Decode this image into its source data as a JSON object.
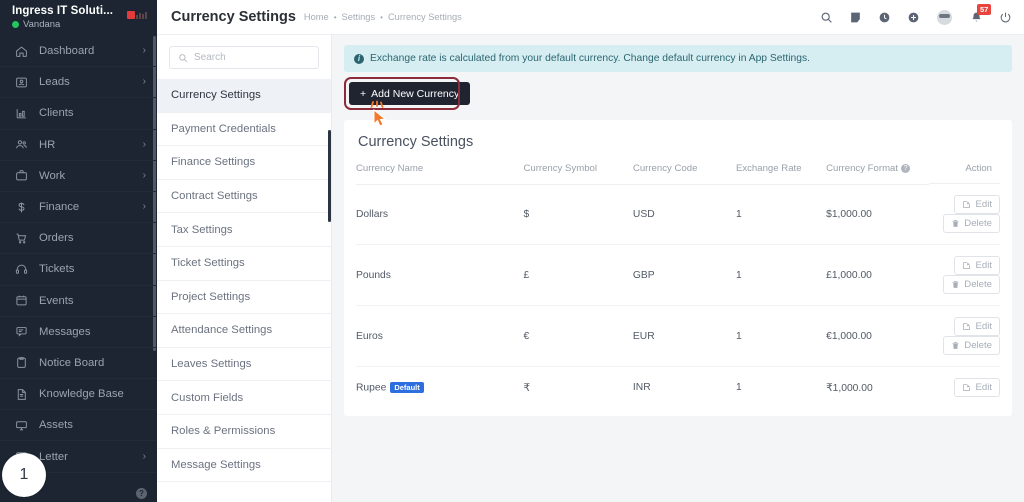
{
  "sidebar": {
    "brand_title": "Ingress IT Soluti...",
    "user_name": "Vandana",
    "step_badge": "1",
    "items": [
      {
        "label": "Dashboard",
        "icon": "home-icon",
        "chevron": "›"
      },
      {
        "label": "Leads",
        "icon": "leads-icon",
        "chevron": "›"
      },
      {
        "label": "Clients",
        "icon": "clients-icon",
        "chevron": ""
      },
      {
        "label": "HR",
        "icon": "hr-icon",
        "chevron": "›"
      },
      {
        "label": "Work",
        "icon": "work-icon",
        "chevron": "›"
      },
      {
        "label": "Finance",
        "icon": "finance-icon",
        "chevron": "›"
      },
      {
        "label": "Orders",
        "icon": "orders-icon",
        "chevron": ""
      },
      {
        "label": "Tickets",
        "icon": "tickets-icon",
        "chevron": ""
      },
      {
        "label": "Events",
        "icon": "events-icon",
        "chevron": ""
      },
      {
        "label": "Messages",
        "icon": "messages-icon",
        "chevron": ""
      },
      {
        "label": "Notice Board",
        "icon": "notice-board-icon",
        "chevron": ""
      },
      {
        "label": "Knowledge Base",
        "icon": "knowledge-base-icon",
        "chevron": ""
      },
      {
        "label": "Assets",
        "icon": "assets-icon",
        "chevron": ""
      },
      {
        "label": "Letter",
        "icon": "letter-icon",
        "chevron": "›"
      }
    ]
  },
  "topbar": {
    "page_title": "Currency Settings",
    "breadcrumbs": [
      "Home",
      "Settings",
      "Currency Settings"
    ],
    "separator": "•",
    "notification_count": "57",
    "icons": [
      "search-icon",
      "note-icon",
      "clock-icon",
      "plus-icon",
      "avatar",
      "bell-icon",
      "power-icon"
    ]
  },
  "subnav": {
    "search_placeholder": "Search",
    "search_value": "",
    "active": "Currency Settings",
    "items": [
      "Currency Settings",
      "Payment Credentials",
      "Finance Settings",
      "Contract Settings",
      "Tax Settings",
      "Ticket Settings",
      "Project Settings",
      "Attendance Settings",
      "Leaves Settings",
      "Custom Fields",
      "Roles & Permissions",
      "Message Settings"
    ]
  },
  "main": {
    "alert_text": "Exchange rate is calculated from your default currency. Change default currency in App Settings.",
    "add_button_label": "Add New Currency",
    "add_button_plus": "+",
    "card_title": "Currency Settings",
    "columns": [
      "Currency Name",
      "Currency Symbol",
      "Currency Code",
      "Exchange Rate",
      "Currency Format",
      "Action"
    ],
    "format_help_tooltip": "?",
    "default_badge": "Default",
    "edit_label": "Edit",
    "delete_label": "Delete",
    "rows": [
      {
        "name": "Dollars",
        "symbol": "$",
        "code": "USD",
        "rate": "1",
        "format": "$1,000.00",
        "is_default": false,
        "can_delete": true
      },
      {
        "name": "Pounds",
        "symbol": "£",
        "code": "GBP",
        "rate": "1",
        "format": "£1,000.00",
        "is_default": false,
        "can_delete": true
      },
      {
        "name": "Euros",
        "symbol": "€",
        "code": "EUR",
        "rate": "1",
        "format": "€1,000.00",
        "is_default": false,
        "can_delete": true
      },
      {
        "name": "Rupee",
        "symbol": "₹",
        "code": "INR",
        "rate": "1",
        "format": "₹1,000.00",
        "is_default": true,
        "can_delete": false
      }
    ]
  },
  "colors": {
    "sidebar_bg": "#1c2531",
    "accent_blue": "#2e6fe0",
    "alert_bg": "#d6edf2",
    "alert_text": "#2b6670",
    "button_dark": "#1f2430",
    "click_ring": "#8c2b3a",
    "cursor": "#f4792b",
    "badge_red": "#e8453c",
    "online_green": "#22c55e"
  }
}
